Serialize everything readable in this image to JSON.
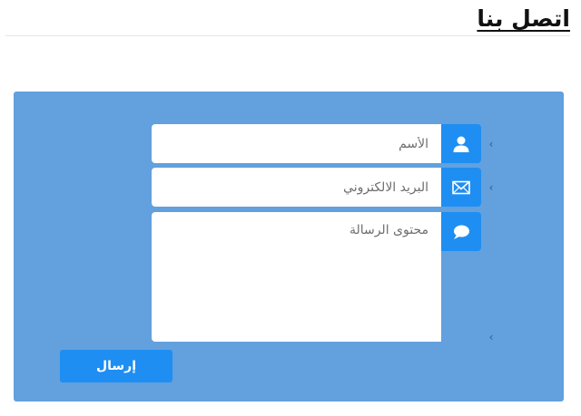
{
  "page": {
    "title": "اتصل بنا"
  },
  "form": {
    "name_placeholder": "الأسم",
    "email_placeholder": "البريد الالكتروني",
    "message_placeholder": "محتوى الرسالة",
    "submit_label": "إرسال",
    "name_icon": "user-icon",
    "email_icon": "envelope-icon",
    "message_icon": "speech-bubble-icon"
  },
  "colors": {
    "panel": "#62a0de",
    "accent": "#1e8ef2",
    "field": "#ffffff"
  }
}
